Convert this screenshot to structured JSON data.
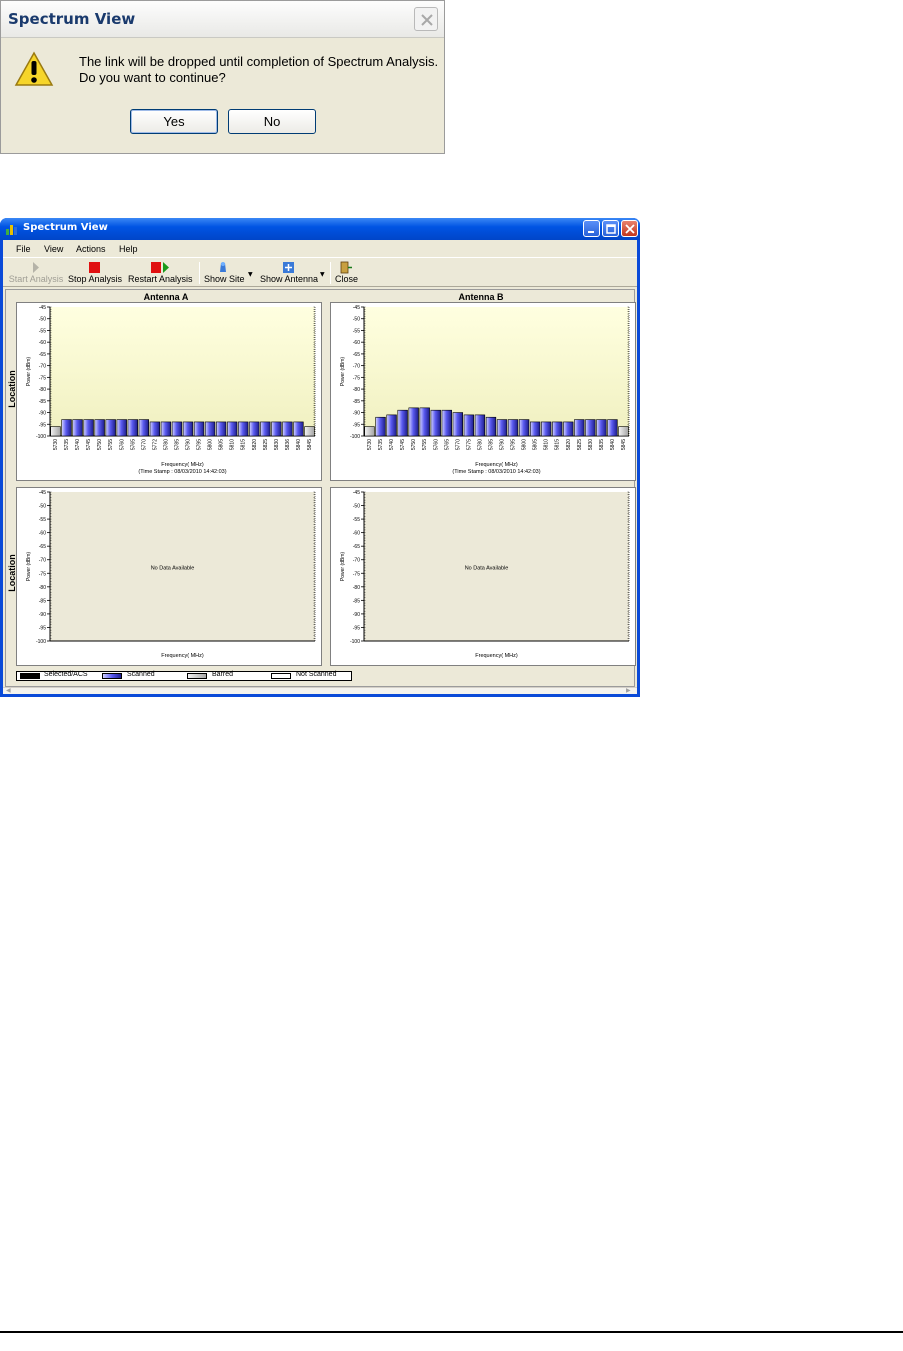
{
  "dialog": {
    "title": "Spectrum View",
    "message_line1": "The link will be dropped until completion of Spectrum Analysis.",
    "message_line2": "Do you want to continue?",
    "yes_label": "Yes",
    "no_label": "No",
    "icon": "warning-icon"
  },
  "window": {
    "title": "Spectrum View",
    "menu": [
      "File",
      "View",
      "Actions",
      "Help"
    ],
    "toolbar": {
      "start": "Start Analysis",
      "stop": "Stop Analysis",
      "restart": "Restart Analysis",
      "show_site": "Show Site",
      "show_antenna": "Show Antenna",
      "close": "Close"
    },
    "antenna_a": "Antenna A",
    "antenna_b": "Antenna B",
    "location_label": "Location",
    "legend": {
      "selected": "Selected/ACS",
      "scanned": "Scanned",
      "barred": "Barred",
      "not_scanned": "Not Scanned"
    }
  },
  "colors": {
    "scanned": "#5a5af0",
    "barred": "#c0c0c0",
    "selected": "#000000",
    "plot_bg_top": "#ffffe0",
    "plot_bg_bottom": "#f0f0c0"
  },
  "chart_data": [
    {
      "type": "bar",
      "title": "",
      "ylabel": "Power (dBm)",
      "xlabel": "Frequency( MHz)",
      "timestamp": "(Time Stamp : 08/03/2010 14:42:03)",
      "ylim": [
        -100,
        -45
      ],
      "yticks": [
        -45,
        -50,
        -55,
        -60,
        -65,
        -70,
        -75,
        -80,
        -85,
        -90,
        -95,
        -100
      ],
      "categories": [
        "5730",
        "5735",
        "5740",
        "5745",
        "5750",
        "5755",
        "5760",
        "5765",
        "5770",
        "5775",
        "5780",
        "5785",
        "5790",
        "5795",
        "5800",
        "5805",
        "5810",
        "5815",
        "5820",
        "5825",
        "5830",
        "5835",
        "5840",
        "5845"
      ],
      "tick_labels": [
        "5730",
        "5735",
        "5740",
        "5745",
        "5750",
        "5755",
        "5760",
        "5765",
        "5770",
        "5772",
        "5780",
        "5785",
        "5790",
        "5795",
        "5800",
        "5805",
        "5810",
        "5815",
        "5820",
        "5825",
        "5830",
        "5836",
        "5840",
        "5845"
      ],
      "values": [
        -96,
        -93,
        -93,
        -93,
        -93,
        -93,
        -93,
        -93,
        -93,
        -94,
        -94,
        -94,
        -94,
        -94,
        -94,
        -94,
        -94,
        -94,
        -94,
        -94,
        -94,
        -94,
        -94,
        -96
      ],
      "status": [
        "barred",
        "scanned",
        "scanned",
        "scanned",
        "scanned",
        "scanned",
        "scanned",
        "scanned",
        "scanned",
        "scanned",
        "scanned",
        "scanned",
        "scanned",
        "scanned",
        "scanned",
        "scanned",
        "scanned",
        "scanned",
        "scanned",
        "scanned",
        "scanned",
        "scanned",
        "scanned",
        "barred"
      ]
    },
    {
      "type": "bar",
      "title": "",
      "ylabel": "Power (dBm)",
      "xlabel": "Frequency( MHz)",
      "timestamp": "(Time Stamp : 08/03/2010 14:42:03)",
      "ylim": [
        -100,
        -45
      ],
      "yticks": [
        -45,
        -50,
        -55,
        -60,
        -65,
        -70,
        -75,
        -80,
        -85,
        -90,
        -95,
        -100
      ],
      "categories": [
        "5730",
        "5735",
        "5740",
        "5745",
        "5750",
        "5755",
        "5760",
        "5765",
        "5770",
        "5775",
        "5780",
        "5785",
        "5790",
        "5795",
        "5800",
        "5805",
        "5810",
        "5815",
        "5820",
        "5825",
        "5830",
        "5835",
        "5840",
        "5845"
      ],
      "tick_labels": [
        "5730",
        "5735",
        "5740",
        "5745",
        "5750",
        "5755",
        "5760",
        "5765",
        "5770",
        "5775",
        "5780",
        "5785",
        "5790",
        "5795",
        "5800",
        "5805",
        "5810",
        "5815",
        "5820",
        "5825",
        "5830",
        "5835",
        "5840",
        "5845"
      ],
      "values": [
        -96,
        -92,
        -91,
        -89,
        -88,
        -88,
        -89,
        -89,
        -90,
        -91,
        -91,
        -92,
        -93,
        -93,
        -93,
        -94,
        -94,
        -94,
        -94,
        -93,
        -93,
        -93,
        -93,
        -96
      ],
      "status": [
        "barred",
        "scanned",
        "scanned",
        "scanned",
        "scanned",
        "scanned",
        "scanned",
        "scanned",
        "scanned",
        "scanned",
        "scanned",
        "scanned",
        "scanned",
        "scanned",
        "scanned",
        "scanned",
        "scanned",
        "scanned",
        "scanned",
        "scanned",
        "scanned",
        "scanned",
        "scanned",
        "barred"
      ]
    },
    {
      "type": "bar",
      "ylabel": "Power (dBm)",
      "xlabel": "Frequency( MHz)",
      "message": "No Data Available",
      "ylim": [
        -100,
        -45
      ],
      "yticks": [
        -45,
        -50,
        -55,
        -60,
        -65,
        -70,
        -75,
        -80,
        -85,
        -90,
        -95,
        -100
      ],
      "values": []
    },
    {
      "type": "bar",
      "ylabel": "Power (dBm)",
      "xlabel": "Frequency( MHz)",
      "message": "No Data Available",
      "ylim": [
        -100,
        -45
      ],
      "yticks": [
        -45,
        -50,
        -55,
        -60,
        -65,
        -70,
        -75,
        -80,
        -85,
        -90,
        -95,
        -100
      ],
      "values": []
    }
  ]
}
